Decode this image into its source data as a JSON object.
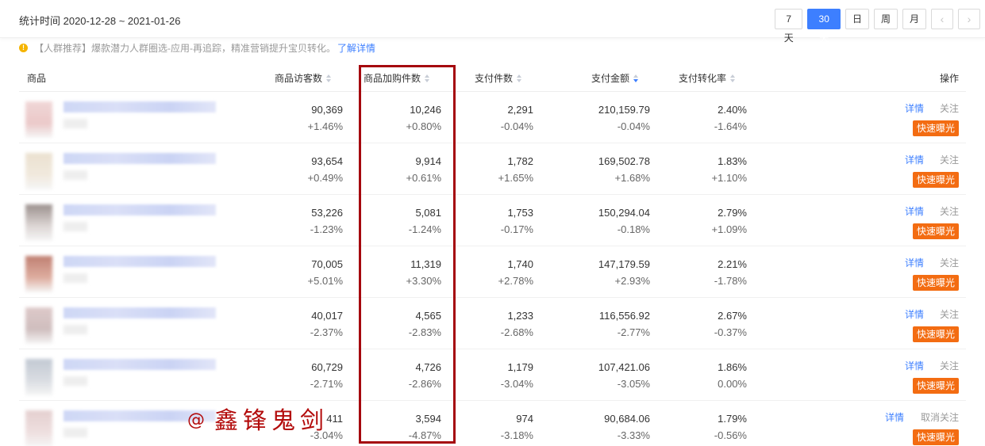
{
  "header": {
    "stat_time": "统计时间 2020-12-28 ~ 2021-01-26",
    "ranges": [
      {
        "label": "7天"
      },
      {
        "label": "30天",
        "active": true
      },
      {
        "label": "日"
      },
      {
        "label": "周"
      },
      {
        "label": "月"
      }
    ],
    "prev": "‹",
    "next": "›"
  },
  "notice": {
    "text": "【人群推荐】爆款潜力人群圈选-应用-再追踪，精准营销提升宝贝转化。",
    "link": "了解详情"
  },
  "columns": [
    "商品",
    "商品访客数",
    "商品加购件数",
    "支付件数",
    "支付金额",
    "支付转化率",
    "操作"
  ],
  "colors": {
    "accent": "#3d7fff",
    "highlight_border": "#a5080e",
    "fast_button": "#f36c12",
    "watermark": "#b30b0b"
  },
  "rows": [
    {
      "visitors": "90,369",
      "visitors_chg": "+1.46%",
      "cart": "10,246",
      "cart_chg": "+0.80%",
      "pay_qty": "2,291",
      "pay_qty_chg": "-0.04%",
      "amount": "210,159.79",
      "amount_chg": "-0.04%",
      "rate": "2.40%",
      "rate_chg": "-1.64%",
      "detail": "详情",
      "follow": "关注",
      "fast": "快速曝光",
      "thumb_colors": [
        "#eed0d0",
        "#e8c0c0"
      ]
    },
    {
      "visitors": "93,654",
      "visitors_chg": "+0.49%",
      "cart": "9,914",
      "cart_chg": "+0.61%",
      "pay_qty": "1,782",
      "pay_qty_chg": "+1.65%",
      "amount": "169,502.78",
      "amount_chg": "+1.68%",
      "rate": "1.83%",
      "rate_chg": "+1.10%",
      "detail": "详情",
      "follow": "关注",
      "fast": "快速曝光",
      "thumb_colors": [
        "#e8dcc8",
        "#efe6d8"
      ]
    },
    {
      "visitors": "53,226",
      "visitors_chg": "-1.23%",
      "cart": "5,081",
      "cart_chg": "-1.24%",
      "pay_qty": "1,753",
      "pay_qty_chg": "-0.17%",
      "amount": "150,294.04",
      "amount_chg": "-0.18%",
      "rate": "2.79%",
      "rate_chg": "+1.09%",
      "detail": "详情",
      "follow": "关注",
      "fast": "快速曝光",
      "thumb_colors": [
        "#8a7d7a",
        "#d8d0ce"
      ]
    },
    {
      "visitors": "70,005",
      "visitors_chg": "+5.01%",
      "cart": "11,319",
      "cart_chg": "+3.30%",
      "pay_qty": "1,740",
      "pay_qty_chg": "+2.78%",
      "amount": "147,179.59",
      "amount_chg": "+2.93%",
      "rate": "2.21%",
      "rate_chg": "-1.78%",
      "detail": "详情",
      "follow": "关注",
      "fast": "快速曝光",
      "thumb_colors": [
        "#b56a5a",
        "#d9a090"
      ]
    },
    {
      "visitors": "40,017",
      "visitors_chg": "-2.37%",
      "cart": "4,565",
      "cart_chg": "-2.83%",
      "pay_qty": "1,233",
      "pay_qty_chg": "-2.68%",
      "amount": "116,556.92",
      "amount_chg": "-2.77%",
      "rate": "2.67%",
      "rate_chg": "-0.37%",
      "detail": "详情",
      "follow": "关注",
      "fast": "快速曝光",
      "thumb_colors": [
        "#d8c0c0",
        "#c8b4b4"
      ]
    },
    {
      "visitors": "60,729",
      "visitors_chg": "-2.71%",
      "cart": "4,726",
      "cart_chg": "-2.86%",
      "pay_qty": "1,179",
      "pay_qty_chg": "-3.04%",
      "amount": "107,421.06",
      "amount_chg": "-3.05%",
      "rate": "1.86%",
      "rate_chg": "0.00%",
      "detail": "详情",
      "follow": "关注",
      "fast": "快速曝光",
      "thumb_colors": [
        "#b8c0cc",
        "#d4d8de"
      ]
    },
    {
      "visitors": "411",
      "visitors_chg": "-3.04%",
      "cart": "3,594",
      "cart_chg": "-4.87%",
      "pay_qty": "974",
      "pay_qty_chg": "-3.18%",
      "amount": "90,684.06",
      "amount_chg": "-3.33%",
      "rate": "1.79%",
      "rate_chg": "-0.56%",
      "detail": "详情",
      "follow": "取消关注",
      "fast": "快速曝光",
      "thumb_colors": [
        "#e0c8c8",
        "#ecdada"
      ]
    }
  ],
  "watermark": {
    "at": "@",
    "text": "鑫锋鬼剑"
  }
}
